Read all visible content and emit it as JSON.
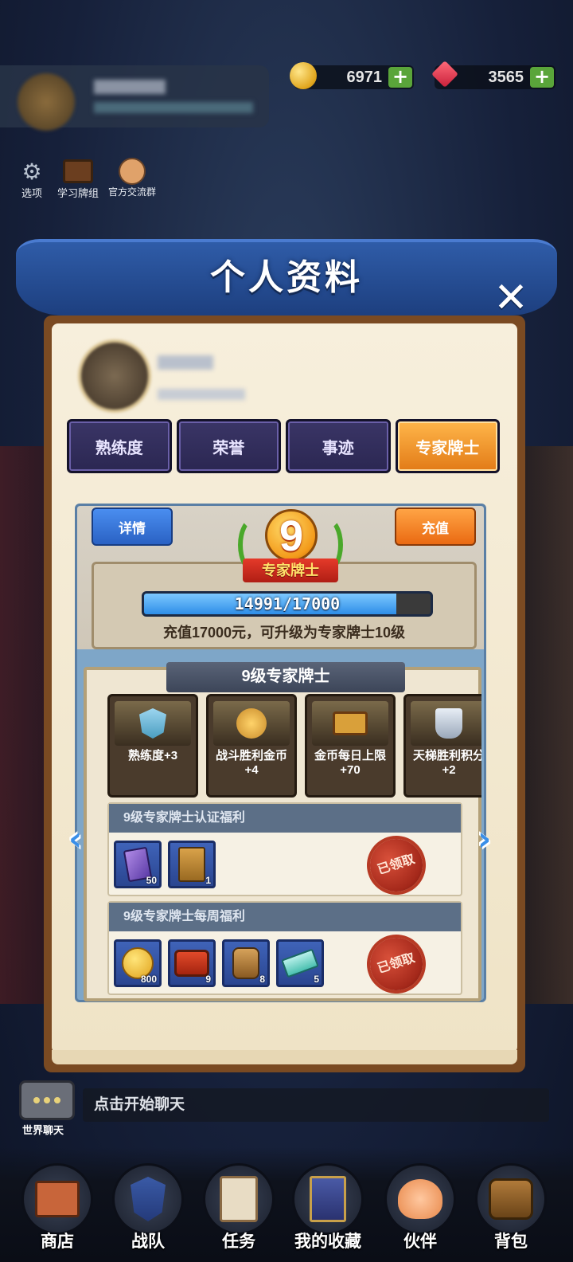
{
  "topbar": {
    "gold": "6971",
    "gems": "3565",
    "plus": "+"
  },
  "side_buttons": [
    {
      "label": "选项",
      "icon": "gear-icon"
    },
    {
      "label": "学习牌组",
      "icon": "tv-icon"
    },
    {
      "label": "官方交流群",
      "icon": "group-icon"
    }
  ],
  "modal": {
    "title": "个人资料",
    "close": "✕",
    "tabs": [
      "熟练度",
      "荣誉",
      "事迹",
      "专家牌士"
    ],
    "active_tab": "专家牌士",
    "expert": {
      "detail_label": "详情",
      "charge_label": "充值",
      "level": "9",
      "level_title": "专家牌士",
      "progress_current": 14991,
      "progress_max": 17000,
      "progress_text": "14991/17000",
      "hint": "充值17000元，可升级为专家牌士10级",
      "sheet_title": "9级专家牌士",
      "perks": [
        {
          "label": "熟练度+3",
          "icon": "shield-arrow-icon"
        },
        {
          "label": "战斗胜利金币+4",
          "icon": "fist-coin-icon"
        },
        {
          "label": "金币每日上限+70",
          "icon": "treasure-chest-icon"
        },
        {
          "label": "天梯胜利积分+2",
          "icon": "trophy-icon"
        }
      ],
      "cert_benefit": {
        "title": "9级专家牌士认证福利",
        "items": [
          {
            "icon": "purple-card-icon",
            "count": "50"
          },
          {
            "icon": "gold-card-icon",
            "count": "1"
          }
        ],
        "status": "已领取"
      },
      "weekly_benefit": {
        "title": "9级专家牌士每周福利",
        "items": [
          {
            "icon": "coin-icon",
            "count": "800"
          },
          {
            "icon": "red-chest-icon",
            "count": "9"
          },
          {
            "icon": "pouch-icon",
            "count": "8"
          },
          {
            "icon": "ticket-icon",
            "count": "5"
          }
        ],
        "status": "已领取"
      }
    }
  },
  "chat": {
    "icon_label": "世界聊天",
    "placeholder": "点击开始聊天"
  },
  "bottom_nav": [
    {
      "label": "商店",
      "icon": "shop-icon"
    },
    {
      "label": "战队",
      "icon": "team-banner-icon"
    },
    {
      "label": "任务",
      "icon": "quest-scroll-icon"
    },
    {
      "label": "我的收藏",
      "icon": "card-collection-icon"
    },
    {
      "label": "伙伴",
      "icon": "paw-icon"
    },
    {
      "label": "背包",
      "icon": "backpack-icon"
    }
  ]
}
